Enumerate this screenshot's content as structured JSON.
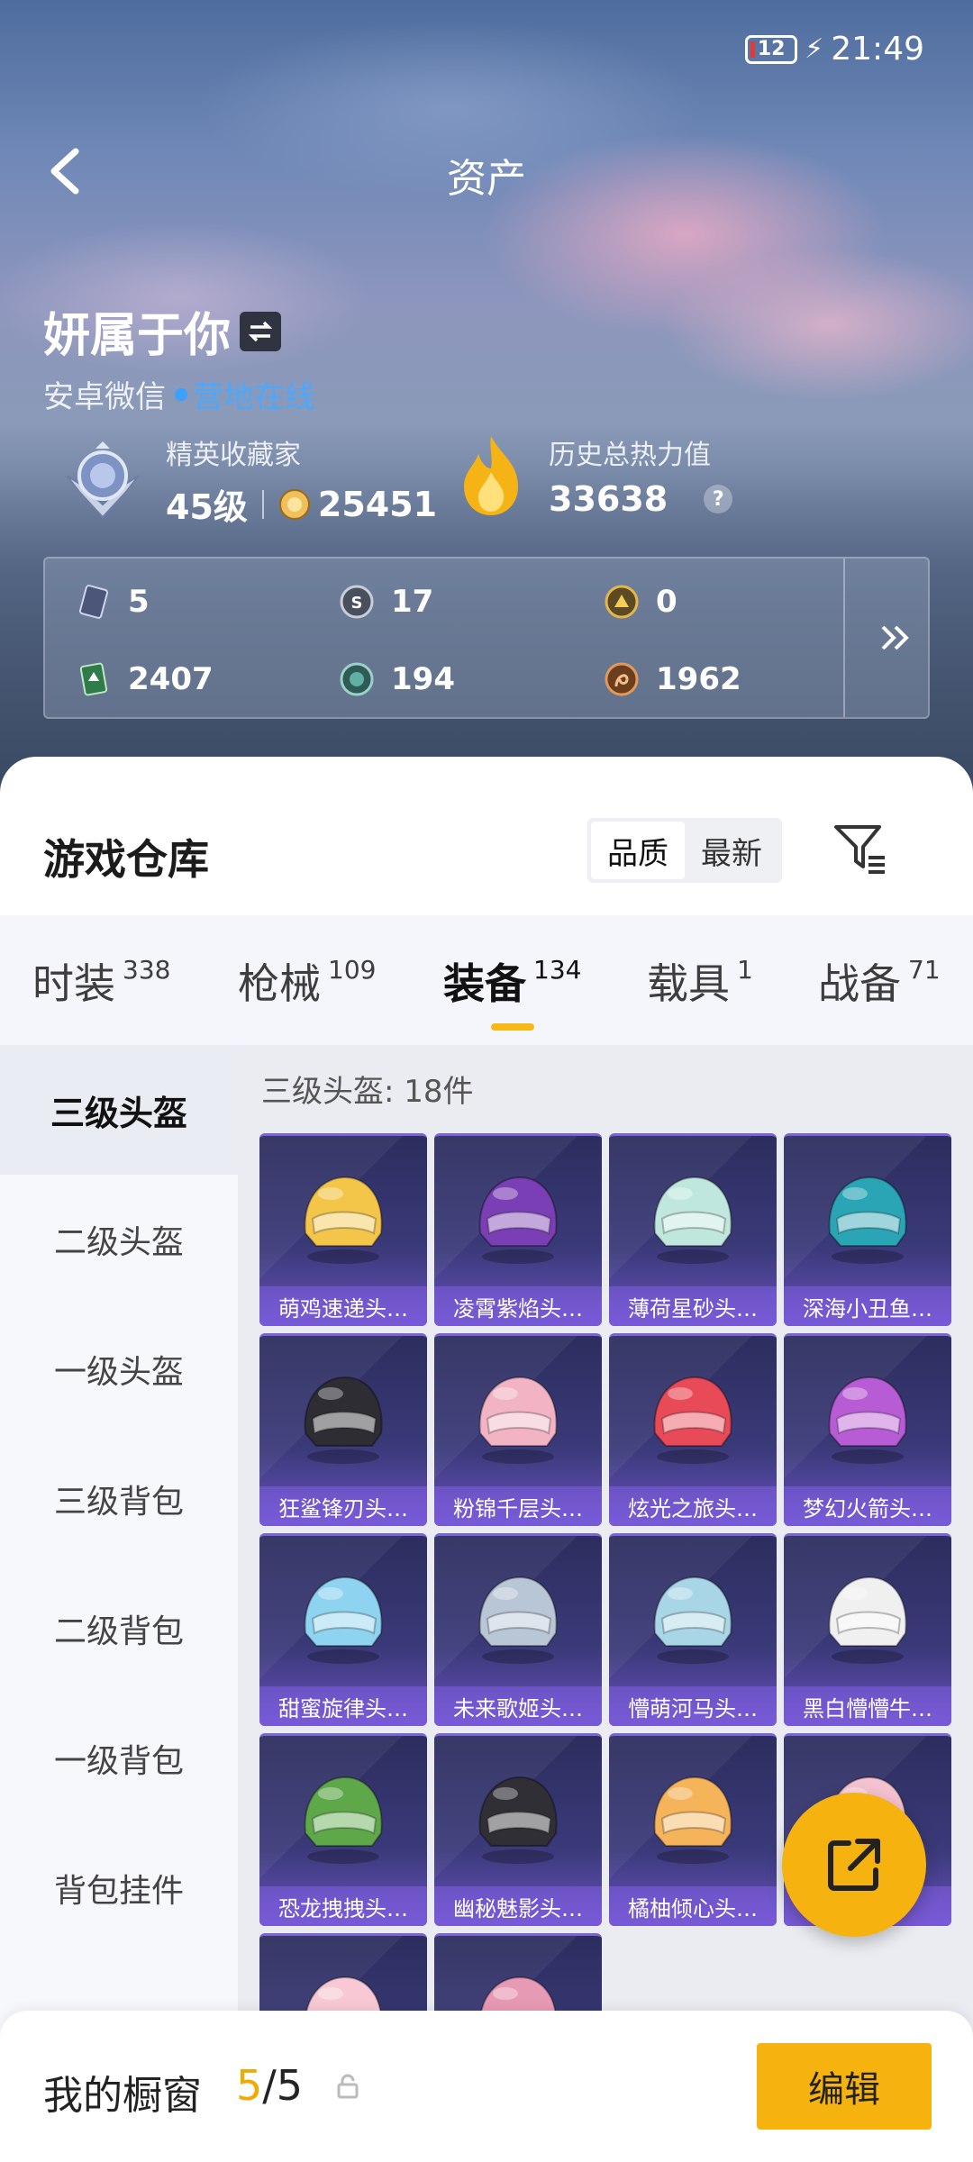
{
  "status": {
    "battery": "12",
    "time": "21:49"
  },
  "nav": {
    "title": "资产"
  },
  "profile": {
    "name": "妍属于你",
    "platform": "安卓微信",
    "online_status": "营地在线",
    "collector_title": "精英收藏家",
    "level": "45级",
    "collector_points": "25451",
    "heat_label": "历史总热力值",
    "heat_value": "33638",
    "help": "?"
  },
  "currencies": [
    {
      "icon": "ticket-icon",
      "value": "5"
    },
    {
      "icon": "silver-coin-icon",
      "value": "17"
    },
    {
      "icon": "gold-coin-icon",
      "value": "0"
    },
    {
      "icon": "green-card-icon",
      "value": "2407"
    },
    {
      "icon": "teal-coin-icon",
      "value": "194"
    },
    {
      "icon": "bronze-coin-icon",
      "value": "1962"
    }
  ],
  "warehouse": {
    "title": "游戏仓库",
    "sort_options": [
      "品质",
      "最新"
    ],
    "active_sort": "品质"
  },
  "tabs": [
    {
      "label": "时装",
      "count": "338"
    },
    {
      "label": "枪械",
      "count": "109"
    },
    {
      "label": "装备",
      "count": "134"
    },
    {
      "label": "载具",
      "count": "1"
    },
    {
      "label": "战备",
      "count": "71"
    }
  ],
  "active_tab": "装备",
  "sidebar": {
    "items": [
      "三级头盔",
      "二级头盔",
      "一级头盔",
      "三级背包",
      "二级背包",
      "一级背包",
      "背包挂件"
    ]
  },
  "content": {
    "count_label": "三级头盔: 18件",
    "items": [
      {
        "name": "萌鸡速递头…",
        "color": "#f3c64a"
      },
      {
        "name": "凌霄紫焰头…",
        "color": "#7a3fb5"
      },
      {
        "name": "薄荷星砂头…",
        "color": "#bfe7dd"
      },
      {
        "name": "深海小丑鱼…",
        "color": "#2aa5b5"
      },
      {
        "name": "狂鲨锋刃头…",
        "color": "#2d2d33"
      },
      {
        "name": "粉锦千层头…",
        "color": "#f2b4c4"
      },
      {
        "name": "炫光之旅头…",
        "color": "#e84a57"
      },
      {
        "name": "梦幻火箭头…",
        "color": "#b85cd6"
      },
      {
        "name": "甜蜜旋律头…",
        "color": "#8ed3f0"
      },
      {
        "name": "未来歌姬头…",
        "color": "#b9c6d6"
      },
      {
        "name": "懵萌河马头…",
        "color": "#a9d6e6"
      },
      {
        "name": "黑白懵懵牛…",
        "color": "#f0f0f0"
      },
      {
        "name": "恐龙拽拽头…",
        "color": "#5ea84a"
      },
      {
        "name": "幽秘魅影头…",
        "color": "#2f2f35"
      },
      {
        "name": "橘柚倾心头…",
        "color": "#f5b35a"
      },
      {
        "name": "",
        "color": "#f5c2cf"
      },
      {
        "name": "",
        "color": "#f8c9d4"
      },
      {
        "name": "",
        "color": "#e79ab4"
      }
    ]
  },
  "bottom": {
    "showcase_label": "我的橱窗",
    "showcase_current": "5",
    "showcase_total": "/5",
    "edit_label": "编辑"
  }
}
